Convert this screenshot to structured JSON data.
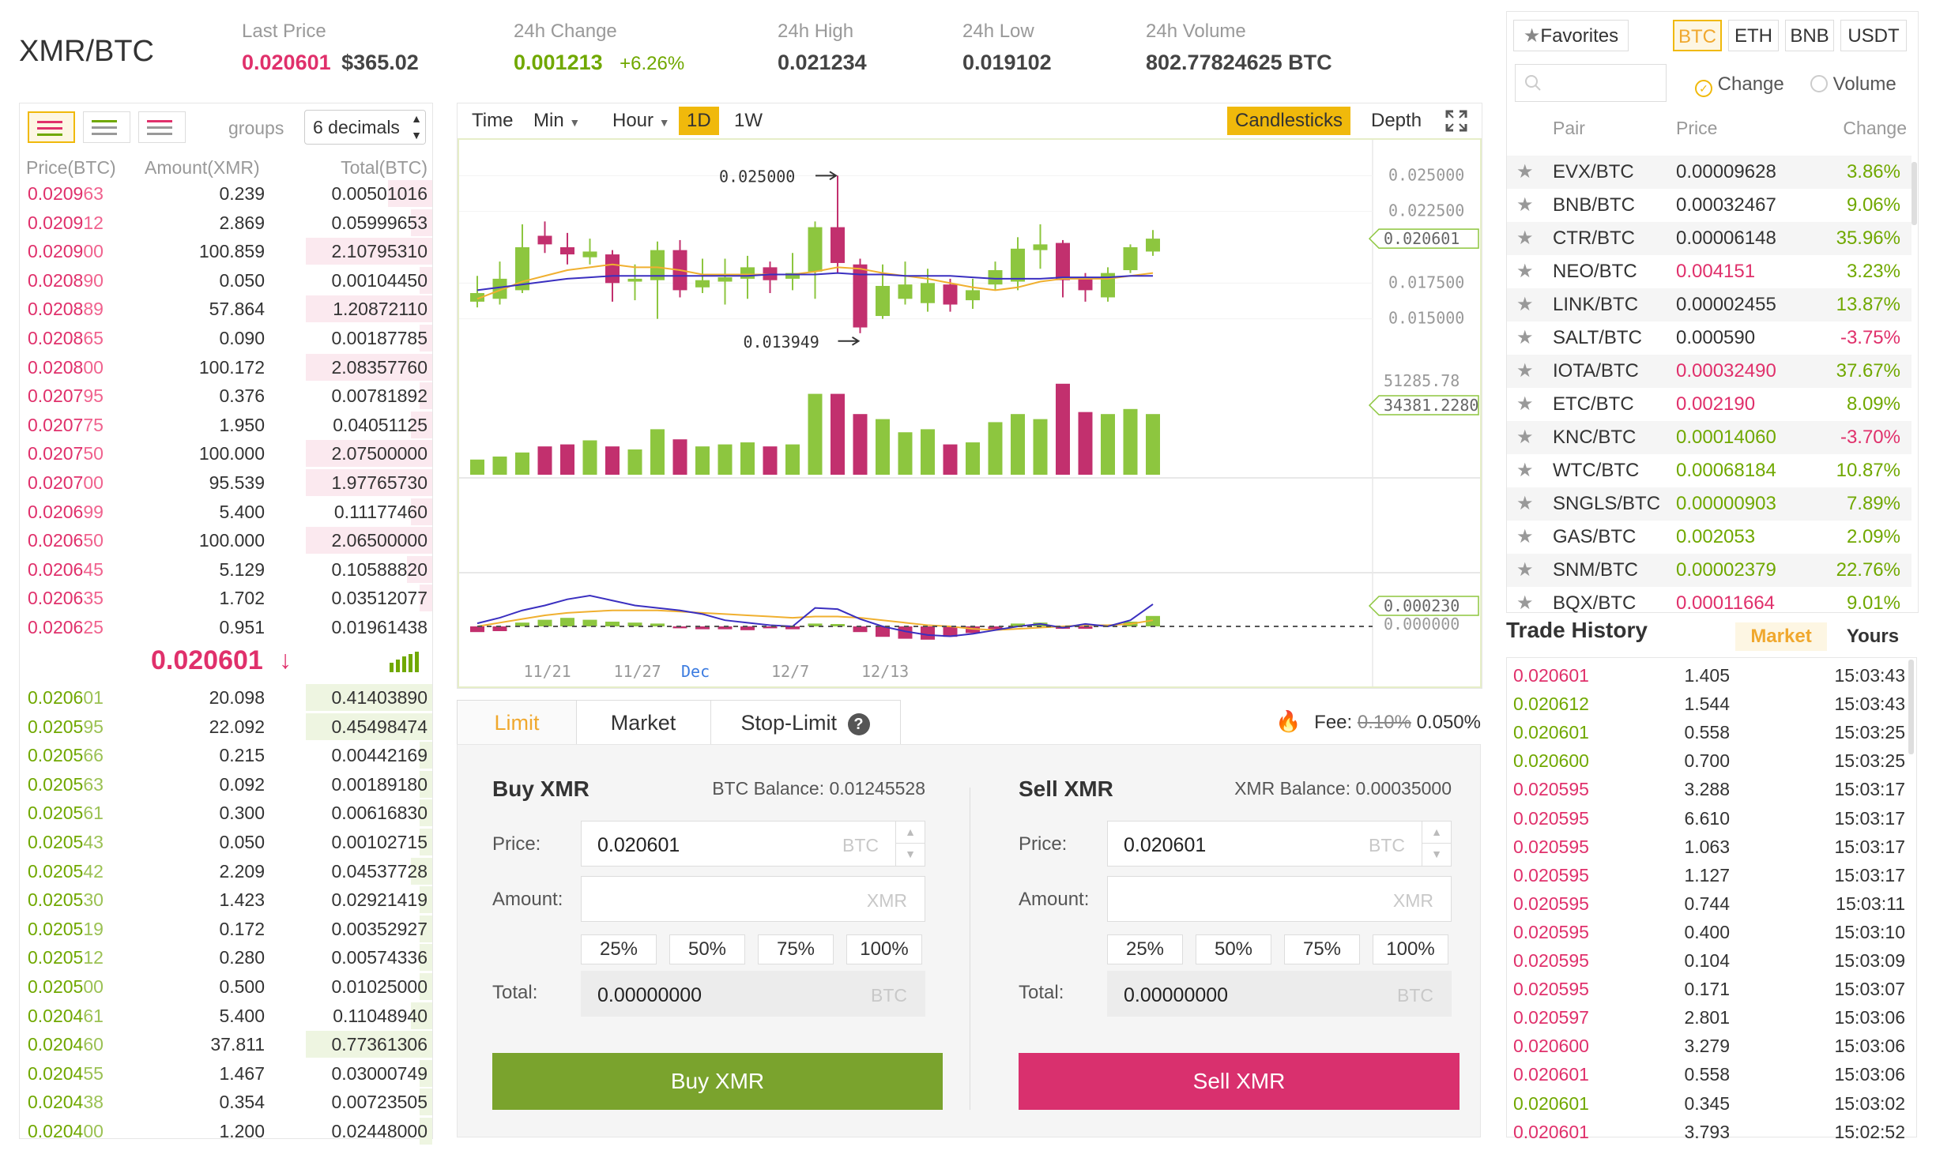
{
  "ticker": {
    "pair": "XMR/BTC",
    "last_price_label": "Last Price",
    "last_price": "0.020601",
    "last_price_usd": "$365.02",
    "change_label": "24h Change",
    "change": "0.001213",
    "change_pct": "+6.26%",
    "high_label": "24h High",
    "high": "0.021234",
    "low_label": "24h Low",
    "low": "0.019102",
    "volume_label": "24h Volume",
    "volume": "802.77824625 BTC"
  },
  "orderbook": {
    "groups_label": "groups",
    "groups_value": "6 decimals",
    "col_price": "Price(BTC)",
    "col_amount": "Amount(XMR)",
    "col_total": "Total(BTC)",
    "last_price": "0.020601",
    "last_arrow": "↓",
    "asks": [
      {
        "pa": "0.0209",
        "pb": "63",
        "amount": "0.239",
        "total": "0.00501016",
        "depth": 0.35
      },
      {
        "pa": "0.0209",
        "pb": "12",
        "amount": "2.869",
        "total": "0.05999653",
        "depth": 0.17
      },
      {
        "pa": "0.0209",
        "pb": "00",
        "amount": "100.859",
        "total": "2.10795310",
        "depth": 1.0
      },
      {
        "pa": "0.0208",
        "pb": "90",
        "amount": "0.050",
        "total": "0.00104450",
        "depth": 0.1
      },
      {
        "pa": "0.0208",
        "pb": "89",
        "amount": "57.864",
        "total": "1.20872110",
        "depth": 1.0
      },
      {
        "pa": "0.0208",
        "pb": "65",
        "amount": "0.090",
        "total": "0.00187785",
        "depth": 0.1
      },
      {
        "pa": "0.0208",
        "pb": "00",
        "amount": "100.172",
        "total": "2.08357760",
        "depth": 1.0
      },
      {
        "pa": "0.0207",
        "pb": "95",
        "amount": "0.376",
        "total": "0.00781892",
        "depth": 0.1
      },
      {
        "pa": "0.0207",
        "pb": "75",
        "amount": "1.950",
        "total": "0.04051125",
        "depth": 0.17
      },
      {
        "pa": "0.0207",
        "pb": "50",
        "amount": "100.000",
        "total": "2.07500000",
        "depth": 1.0
      },
      {
        "pa": "0.0207",
        "pb": "00",
        "amount": "95.539",
        "total": "1.97765730",
        "depth": 1.0
      },
      {
        "pa": "0.0206",
        "pb": "99",
        "amount": "5.400",
        "total": "0.11177460",
        "depth": 0.17
      },
      {
        "pa": "0.0206",
        "pb": "50",
        "amount": "100.000",
        "total": "2.06500000",
        "depth": 1.0
      },
      {
        "pa": "0.0206",
        "pb": "45",
        "amount": "5.129",
        "total": "0.10588820",
        "depth": 0.2
      },
      {
        "pa": "0.0206",
        "pb": "35",
        "amount": "1.702",
        "total": "0.03512077",
        "depth": 0.1
      },
      {
        "pa": "0.0206",
        "pb": "25",
        "amount": "0.951",
        "total": "0.01961438",
        "depth": 0.0
      }
    ],
    "bids": [
      {
        "pa": "0.0206",
        "pb": "01",
        "amount": "20.098",
        "total": "0.41403890",
        "depth": 1.0
      },
      {
        "pa": "0.0205",
        "pb": "95",
        "amount": "22.092",
        "total": "0.45498474",
        "depth": 1.0
      },
      {
        "pa": "0.0205",
        "pb": "66",
        "amount": "0.215",
        "total": "0.00442169",
        "depth": 0.1
      },
      {
        "pa": "0.0205",
        "pb": "63",
        "amount": "0.092",
        "total": "0.00189180",
        "depth": 0.1
      },
      {
        "pa": "0.0205",
        "pb": "61",
        "amount": "0.300",
        "total": "0.00616830",
        "depth": 0.1
      },
      {
        "pa": "0.0205",
        "pb": "43",
        "amount": "0.050",
        "total": "0.00102715",
        "depth": 0.1
      },
      {
        "pa": "0.0205",
        "pb": "42",
        "amount": "2.209",
        "total": "0.04537728",
        "depth": 0.17
      },
      {
        "pa": "0.0205",
        "pb": "30",
        "amount": "1.423",
        "total": "0.02921419",
        "depth": 0.1
      },
      {
        "pa": "0.0205",
        "pb": "19",
        "amount": "0.172",
        "total": "0.00352927",
        "depth": 0.1
      },
      {
        "pa": "0.0205",
        "pb": "12",
        "amount": "0.280",
        "total": "0.00574336",
        "depth": 0.1
      },
      {
        "pa": "0.0205",
        "pb": "00",
        "amount": "0.500",
        "total": "0.01025000",
        "depth": 0.1
      },
      {
        "pa": "0.0204",
        "pb": "61",
        "amount": "5.400",
        "total": "0.11048940",
        "depth": 0.17
      },
      {
        "pa": "0.0204",
        "pb": "60",
        "amount": "37.811",
        "total": "0.77361306",
        "depth": 1.0
      },
      {
        "pa": "0.0204",
        "pb": "55",
        "amount": "1.467",
        "total": "0.03000749",
        "depth": 0.1
      },
      {
        "pa": "0.0204",
        "pb": "38",
        "amount": "0.354",
        "total": "0.00723505",
        "depth": 0.1
      },
      {
        "pa": "0.0204",
        "pb": "00",
        "amount": "1.200",
        "total": "0.02448000",
        "depth": 0.1
      }
    ]
  },
  "chart_toolbar": {
    "time": "Time",
    "min": "Min",
    "hour": "Hour",
    "d1": "1D",
    "w1": "1W",
    "candlesticks": "Candlesticks",
    "depth": "Depth"
  },
  "chart_data": {
    "type": "candlestick",
    "price_ticks": [
      "0.025000",
      "0.022500",
      "0.017500",
      "0.015000"
    ],
    "price_ylim": [
      0.0125,
      0.0275
    ],
    "max_label": "0.025000",
    "min_label": "0.013949",
    "last_price_tag": "0.020601",
    "vol_max_label": "51285.78",
    "vol_tag": "34381.2280",
    "macd_tag": "0.000230",
    "macd_zero": "0.000000",
    "x_labels": [
      "11/21",
      "11/27",
      "Dec",
      "12/7",
      "12/13"
    ],
    "candles": [
      {
        "o": 0.0162,
        "c": 0.0168,
        "h": 0.018,
        "l": 0.0158
      },
      {
        "o": 0.0164,
        "c": 0.0178,
        "h": 0.019,
        "l": 0.016
      },
      {
        "o": 0.017,
        "c": 0.02,
        "h": 0.0216,
        "l": 0.0168
      },
      {
        "o": 0.0208,
        "c": 0.0202,
        "h": 0.0218,
        "l": 0.0196
      },
      {
        "o": 0.02,
        "c": 0.0195,
        "h": 0.021,
        "l": 0.0188
      },
      {
        "o": 0.0193,
        "c": 0.0197,
        "h": 0.0206,
        "l": 0.0188
      },
      {
        "o": 0.0195,
        "c": 0.0175,
        "h": 0.0198,
        "l": 0.0162
      },
      {
        "o": 0.0176,
        "c": 0.0178,
        "h": 0.0188,
        "l": 0.0163
      },
      {
        "o": 0.0177,
        "c": 0.0198,
        "h": 0.0204,
        "l": 0.015
      },
      {
        "o": 0.0198,
        "c": 0.017,
        "h": 0.0205,
        "l": 0.0165
      },
      {
        "o": 0.0172,
        "c": 0.0177,
        "h": 0.0192,
        "l": 0.0168
      },
      {
        "o": 0.0176,
        "c": 0.0179,
        "h": 0.0192,
        "l": 0.016
      },
      {
        "o": 0.0178,
        "c": 0.0186,
        "h": 0.0194,
        "l": 0.0164
      },
      {
        "o": 0.0186,
        "c": 0.0177,
        "h": 0.019,
        "l": 0.0168
      },
      {
        "o": 0.0178,
        "c": 0.0182,
        "h": 0.0196,
        "l": 0.017
      },
      {
        "o": 0.0183,
        "c": 0.0214,
        "h": 0.0218,
        "l": 0.0164
      },
      {
        "o": 0.0214,
        "c": 0.0189,
        "h": 0.025,
        "l": 0.0182
      },
      {
        "o": 0.0188,
        "c": 0.0144,
        "h": 0.0192,
        "l": 0.014
      },
      {
        "o": 0.0152,
        "c": 0.0173,
        "h": 0.0188,
        "l": 0.015
      },
      {
        "o": 0.0164,
        "c": 0.0174,
        "h": 0.019,
        "l": 0.016
      },
      {
        "o": 0.0161,
        "c": 0.0175,
        "h": 0.0185,
        "l": 0.0155
      },
      {
        "o": 0.0174,
        "c": 0.016,
        "h": 0.0178,
        "l": 0.0155
      },
      {
        "o": 0.0163,
        "c": 0.017,
        "h": 0.0178,
        "l": 0.0157
      },
      {
        "o": 0.0174,
        "c": 0.0184,
        "h": 0.019,
        "l": 0.017
      },
      {
        "o": 0.0176,
        "c": 0.0199,
        "h": 0.0207,
        "l": 0.017
      },
      {
        "o": 0.0198,
        "c": 0.0202,
        "h": 0.0216,
        "l": 0.0185
      },
      {
        "o": 0.0203,
        "c": 0.0177,
        "h": 0.0205,
        "l": 0.0165
      },
      {
        "o": 0.0178,
        "c": 0.017,
        "h": 0.0182,
        "l": 0.0162
      },
      {
        "o": 0.0165,
        "c": 0.0182,
        "h": 0.0186,
        "l": 0.0162
      },
      {
        "o": 0.0184,
        "c": 0.02,
        "h": 0.0202,
        "l": 0.0182
      },
      {
        "o": 0.0197,
        "c": 0.0206,
        "h": 0.0212,
        "l": 0.0194
      }
    ],
    "volumes": [
      0.15,
      0.18,
      0.22,
      0.28,
      0.3,
      0.34,
      0.28,
      0.25,
      0.45,
      0.35,
      0.28,
      0.3,
      0.32,
      0.28,
      0.3,
      0.8,
      0.8,
      0.6,
      0.55,
      0.42,
      0.45,
      0.3,
      0.32,
      0.52,
      0.6,
      0.55,
      0.9,
      0.62,
      0.6,
      0.65,
      0.6
    ],
    "ma_short": [
      0.0164,
      0.017,
      0.0176,
      0.018,
      0.0184,
      0.0186,
      0.0188,
      0.0186,
      0.0186,
      0.0184,
      0.0181,
      0.0181,
      0.0181,
      0.0181,
      0.0181,
      0.0183,
      0.0186,
      0.0185,
      0.0182,
      0.018,
      0.0178,
      0.0175,
      0.0172,
      0.017,
      0.0172,
      0.0176,
      0.0178,
      0.0178,
      0.0178,
      0.018,
      0.0182
    ],
    "ma_long": [
      0.017,
      0.0172,
      0.0174,
      0.0176,
      0.0178,
      0.0179,
      0.018,
      0.018,
      0.018,
      0.018,
      0.018,
      0.018,
      0.018,
      0.0181,
      0.0181,
      0.0181,
      0.0182,
      0.0181,
      0.0181,
      0.018,
      0.018,
      0.018,
      0.0179,
      0.0178,
      0.0178,
      0.0178,
      0.0179,
      0.0179,
      0.0179,
      0.018,
      0.018
    ],
    "macd_hist": [
      -0.12,
      -0.1,
      0.08,
      0.14,
      0.18,
      0.14,
      0.1,
      0.08,
      0.06,
      -0.04,
      -0.06,
      -0.06,
      -0.08,
      -0.04,
      -0.06,
      0.06,
      0.05,
      -0.12,
      -0.22,
      -0.26,
      -0.28,
      -0.22,
      -0.14,
      -0.06,
      0.06,
      0.08,
      -0.05,
      -0.05,
      0.04,
      0.1,
      0.22
    ],
    "macd_line": [
      0.05,
      0.14,
      0.26,
      0.34,
      0.44,
      0.5,
      0.42,
      0.34,
      0.3,
      0.26,
      0.2,
      0.1,
      0.06,
      0.02,
      0.0,
      0.3,
      0.28,
      0.12,
      0.0,
      -0.08,
      -0.14,
      -0.16,
      -0.12,
      -0.06,
      0.0,
      0.04,
      -0.02,
      0.04,
      0.0,
      0.1,
      0.36
    ],
    "signal_line": [
      0.0,
      0.06,
      0.12,
      0.18,
      0.22,
      0.24,
      0.26,
      0.26,
      0.26,
      0.24,
      0.22,
      0.2,
      0.18,
      0.16,
      0.14,
      0.16,
      0.16,
      0.14,
      0.1,
      0.06,
      0.02,
      0.0,
      -0.04,
      -0.06,
      -0.04,
      -0.02,
      0.0,
      0.02,
      0.02,
      0.04,
      0.1
    ]
  },
  "trade": {
    "tab_limit": "Limit",
    "tab_market": "Market",
    "tab_stop": "Stop-Limit",
    "fee_label": "Fee:",
    "fee_old": "0.10%",
    "fee_new": "0.050%",
    "buy": {
      "title": "Buy XMR",
      "balance": "BTC Balance: 0.01245528",
      "price_label": "Price:",
      "price": "0.020601",
      "price_unit": "BTC",
      "amount_label": "Amount:",
      "amount_unit": "XMR",
      "total_label": "Total:",
      "total": "0.00000000",
      "total_unit": "BTC",
      "button": "Buy XMR"
    },
    "sell": {
      "title": "Sell XMR",
      "balance": "XMR Balance: 0.00035000",
      "price_label": "Price:",
      "price": "0.020601",
      "price_unit": "BTC",
      "amount_label": "Amount:",
      "amount_unit": "XMR",
      "total_label": "Total:",
      "total": "0.00000000",
      "total_unit": "BTC",
      "button": "Sell XMR"
    },
    "pcts": [
      "25%",
      "50%",
      "75%",
      "100%"
    ]
  },
  "markets": {
    "favorites": "Favorites",
    "tabs": [
      "BTC",
      "ETH",
      "BNB",
      "USDT"
    ],
    "change_radio": "Change",
    "volume_radio": "Volume",
    "col_pair": "Pair",
    "col_price": "Price",
    "col_change": "Change",
    "rows": [
      {
        "pair": "EVX/BTC",
        "price": "0.00009628",
        "change": "3.86%",
        "pc": "n",
        "cc": "up"
      },
      {
        "pair": "BNB/BTC",
        "price": "0.00032467",
        "change": "9.06%",
        "pc": "n",
        "cc": "up"
      },
      {
        "pair": "CTR/BTC",
        "price": "0.00006148",
        "change": "35.96%",
        "pc": "n",
        "cc": "up"
      },
      {
        "pair": "NEO/BTC",
        "price": "0.004151",
        "change": "3.23%",
        "pc": "dn",
        "cc": "up"
      },
      {
        "pair": "LINK/BTC",
        "price": "0.00002455",
        "change": "13.87%",
        "pc": "n",
        "cc": "up"
      },
      {
        "pair": "SALT/BTC",
        "price": "0.000590",
        "change": "-3.75%",
        "pc": "n",
        "cc": "dn"
      },
      {
        "pair": "IOTA/BTC",
        "price": "0.00032490",
        "change": "37.67%",
        "pc": "dn",
        "cc": "up"
      },
      {
        "pair": "ETC/BTC",
        "price": "0.002190",
        "change": "8.09%",
        "pc": "dn",
        "cc": "up"
      },
      {
        "pair": "KNC/BTC",
        "price": "0.00014060",
        "change": "-3.70%",
        "pc": "up",
        "cc": "dn"
      },
      {
        "pair": "WTC/BTC",
        "price": "0.00068184",
        "change": "10.87%",
        "pc": "up",
        "cc": "up"
      },
      {
        "pair": "SNGLS/BTC",
        "price": "0.00000903",
        "change": "7.89%",
        "pc": "up",
        "cc": "up"
      },
      {
        "pair": "GAS/BTC",
        "price": "0.002053",
        "change": "2.09%",
        "pc": "up",
        "cc": "up"
      },
      {
        "pair": "SNM/BTC",
        "price": "0.00002379",
        "change": "22.76%",
        "pc": "up",
        "cc": "up"
      },
      {
        "pair": "BQX/BTC",
        "price": "0.00011664",
        "change": "9.01%",
        "pc": "dn",
        "cc": "up"
      }
    ]
  },
  "trade_history": {
    "title": "Trade History",
    "tab_market": "Market",
    "tab_yours": "Yours",
    "rows": [
      {
        "price": "0.020601",
        "amount": "1.405",
        "time": "15:03:43",
        "side": "dn"
      },
      {
        "price": "0.020612",
        "amount": "1.544",
        "time": "15:03:43",
        "side": "up"
      },
      {
        "price": "0.020601",
        "amount": "0.558",
        "time": "15:03:25",
        "side": "up"
      },
      {
        "price": "0.020600",
        "amount": "0.700",
        "time": "15:03:25",
        "side": "up"
      },
      {
        "price": "0.020595",
        "amount": "3.288",
        "time": "15:03:17",
        "side": "dn"
      },
      {
        "price": "0.020595",
        "amount": "6.610",
        "time": "15:03:17",
        "side": "dn"
      },
      {
        "price": "0.020595",
        "amount": "1.063",
        "time": "15:03:17",
        "side": "dn"
      },
      {
        "price": "0.020595",
        "amount": "1.127",
        "time": "15:03:17",
        "side": "dn"
      },
      {
        "price": "0.020595",
        "amount": "0.744",
        "time": "15:03:11",
        "side": "dn"
      },
      {
        "price": "0.020595",
        "amount": "0.400",
        "time": "15:03:10",
        "side": "dn"
      },
      {
        "price": "0.020595",
        "amount": "0.104",
        "time": "15:03:09",
        "side": "dn"
      },
      {
        "price": "0.020595",
        "amount": "0.171",
        "time": "15:03:07",
        "side": "dn"
      },
      {
        "price": "0.020597",
        "amount": "2.801",
        "time": "15:03:06",
        "side": "dn"
      },
      {
        "price": "0.020600",
        "amount": "3.279",
        "time": "15:03:06",
        "side": "dn"
      },
      {
        "price": "0.020601",
        "amount": "0.558",
        "time": "15:03:06",
        "side": "dn"
      },
      {
        "price": "0.020601",
        "amount": "0.345",
        "time": "15:03:02",
        "side": "up"
      },
      {
        "price": "0.020601",
        "amount": "3.793",
        "time": "15:02:52",
        "side": "dn"
      }
    ]
  },
  "colors": {
    "up": "#70a800",
    "down": "#e0306b",
    "accent": "#f0b90b",
    "candle_up": "#8dc63f",
    "candle_down": "#c2306e",
    "ma_short": "#f0b030",
    "ma_long": "#3a2fc0"
  }
}
